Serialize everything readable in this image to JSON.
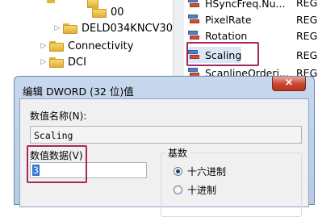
{
  "tree": {
    "items": [
      {
        "label": "00"
      },
      {
        "label": "DELD034KNCV30"
      },
      {
        "label": "Connectivity"
      },
      {
        "label": "DCI"
      }
    ]
  },
  "values": {
    "items": [
      {
        "name": "HSyncFreq.Nu...",
        "type": "REG"
      },
      {
        "name": "PixelRate",
        "type": "REG"
      },
      {
        "name": "Rotation",
        "type": "REG"
      },
      {
        "name": "Scaling",
        "type": "REG"
      },
      {
        "name": "ScanlineOrderi...",
        "type": "REG"
      }
    ],
    "selected": "Scaling"
  },
  "dialog": {
    "title": "编辑 DWORD (32 位)值",
    "close_label": "×",
    "name_label": "数值名称(N):",
    "name_value": "Scaling",
    "data_label": "数值数据(V)",
    "data_value": "3",
    "base_label": "基数",
    "radio_hex": "十六进制",
    "radio_dec": "十进制",
    "selected_base": "hex"
  },
  "colors": {
    "highlight_box": "#a8265c",
    "dialog_frame": "#b7cbe6",
    "close_button": "#c8452e",
    "text_selection": "#3875d7"
  }
}
